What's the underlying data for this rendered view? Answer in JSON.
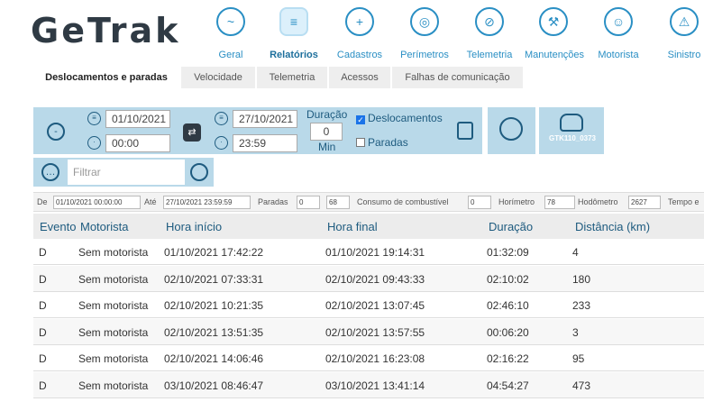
{
  "brand": {
    "logo": "GeTrak"
  },
  "nav": [
    {
      "label": "Geral",
      "icon": "monitor-icon",
      "glyph": "~"
    },
    {
      "label": "Relatórios",
      "icon": "report-icon",
      "glyph": "≡",
      "active": true
    },
    {
      "label": "Cadastros",
      "icon": "folder-add-icon",
      "glyph": "+"
    },
    {
      "label": "Perímetros",
      "icon": "target-icon",
      "glyph": "◎"
    },
    {
      "label": "Telemetria",
      "icon": "compass-icon",
      "glyph": "⊘"
    },
    {
      "label": "Manutenções",
      "icon": "wrench-icon",
      "glyph": "⚒"
    },
    {
      "label": "Motorista",
      "icon": "driver-icon",
      "glyph": "☺"
    },
    {
      "label": "Sinistro",
      "icon": "alarm-icon",
      "glyph": "⚠"
    }
  ],
  "tabs": [
    {
      "label": "Deslocamentos e paradas",
      "active": true
    },
    {
      "label": "Velocidade"
    },
    {
      "label": "Telemetria"
    },
    {
      "label": "Acessos"
    },
    {
      "label": "Falhas de comunicação"
    }
  ],
  "toolbar": {
    "start_date": "01/10/2021",
    "start_time": "00:00",
    "end_date": "27/10/2021",
    "end_time": "23:59",
    "duration_label": "Duração",
    "duration_value": "0",
    "duration_unit": "Min",
    "chk_deslocamentos": "Deslocamentos",
    "chk_deslocamentos_checked": true,
    "chk_paradas": "Paradas",
    "chk_paradas_checked": false,
    "vehicle_plate": "GTK110_0373"
  },
  "filter": {
    "placeholder": "Filtrar"
  },
  "summary": {
    "de_label": "De",
    "de_value": "01/10/2021 00:00:00",
    "ate_label": "Até",
    "ate_value": "27/10/2021 23:59:59",
    "paradas_label": "Paradas",
    "paradas_value": "0",
    "paradas_value2": "68",
    "consumo_label": "Consumo de combustível",
    "consumo_value": "0",
    "horimetro_label": "Horímetro",
    "horimetro_value": "78",
    "hodometro_label": "Hodômetro",
    "hodometro_value": "2627",
    "tempo_label": "Tempo e"
  },
  "table": {
    "headers": [
      "Evento",
      "Motorista",
      "Hora início",
      "Hora final",
      "Duração",
      "Distância (km)"
    ],
    "rows": [
      [
        "D",
        "Sem motorista",
        "01/10/2021 17:42:22",
        "01/10/2021 19:14:31",
        "01:32:09",
        "4"
      ],
      [
        "D",
        "Sem motorista",
        "02/10/2021 07:33:31",
        "02/10/2021 09:43:33",
        "02:10:02",
        "180"
      ],
      [
        "D",
        "Sem motorista",
        "02/10/2021 10:21:35",
        "02/10/2021 13:07:45",
        "02:46:10",
        "233"
      ],
      [
        "D",
        "Sem motorista",
        "02/10/2021 13:51:35",
        "02/10/2021 13:57:55",
        "00:06:20",
        "3"
      ],
      [
        "D",
        "Sem motorista",
        "02/10/2021 14:06:46",
        "02/10/2021 16:23:08",
        "02:16:22",
        "95"
      ],
      [
        "D",
        "Sem motorista",
        "03/10/2021 08:46:47",
        "03/10/2021 13:41:14",
        "04:54:27",
        "473"
      ]
    ]
  }
}
